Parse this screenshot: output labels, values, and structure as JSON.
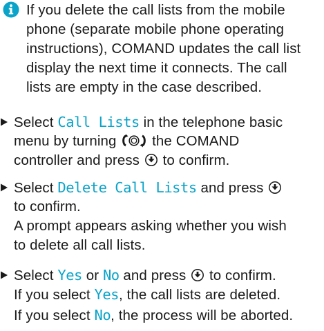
{
  "note": {
    "icon": "info-icon",
    "lines": [
      "If you delete the call lists from the mobile",
      "phone (separate mobile phone operating",
      "instructions), COMAND updates the call list",
      "display the next time it connects. The call",
      "lists are empty in the case described."
    ]
  },
  "steps": [
    {
      "l1_pre": "Select ",
      "l1_hl": "Call Lists",
      "l1_post": " in the telephone basic",
      "l2_pre": "menu by turning ",
      "l2_post": " the COMAND",
      "l3_pre": "controller and press ",
      "l3_post": " to confirm."
    },
    {
      "l1_pre": "Select ",
      "l1_hl": "Delete Call Lists",
      "l1_post": " and press ",
      "l2": "to confirm.",
      "l3": "A prompt appears asking whether you wish",
      "l4": "to delete all call lists."
    },
    {
      "l1_pre": "Select ",
      "l1_hl1": "Yes",
      "l1_mid": " or ",
      "l1_hl2": "No",
      "l1_post": " and press ",
      "l1_end": " to confirm.",
      "l2_pre": "If you select ",
      "l2_hl": "Yes",
      "l2_post": ", the call lists are deleted.",
      "l3_pre": "If you select ",
      "l3_hl": "No",
      "l3_post": ", the process will be aborted."
    }
  ],
  "colors": {
    "accent": "#0aa3c9",
    "text": "#1a1a1a"
  },
  "icons": [
    "info-icon",
    "bullet-arrow-icon",
    "controller-turn-icon",
    "controller-press-icon"
  ]
}
